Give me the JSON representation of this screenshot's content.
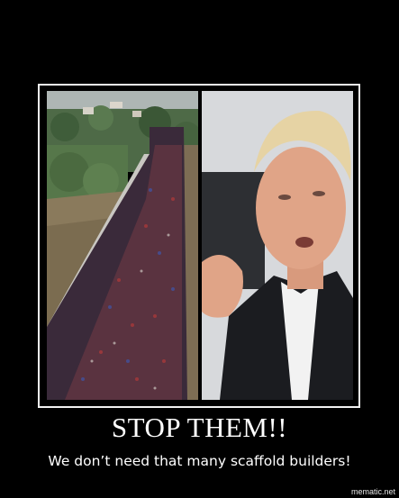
{
  "poster": {
    "title": "STOP THEM!!",
    "caption": "We don’t need that many scaffold builders!",
    "watermark": "mematic.net"
  },
  "images": {
    "left": "aerial-photo-crowd-on-bridge",
    "right": "photo-man-gesturing"
  }
}
